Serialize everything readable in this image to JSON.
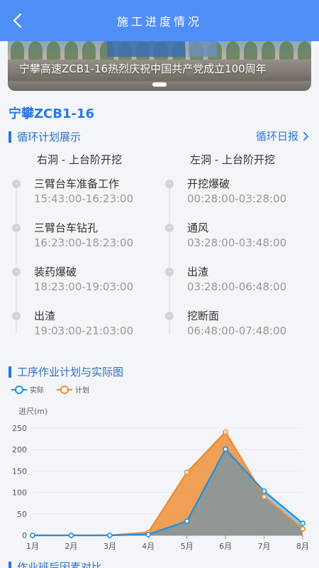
{
  "header": {
    "title": "施工进度情况",
    "back_icon": "chevron-left-icon"
  },
  "banner": {
    "caption": "宁攀高速ZCB1-16热烈庆祝中国共产党成立100周年"
  },
  "project": {
    "name": "宁攀ZCB1-16"
  },
  "cycle": {
    "section_title": "循环计划展示",
    "link_label": "循环日报",
    "left": {
      "heading": "右洞 - 上台阶开挖",
      "steps": [
        {
          "name": "三臂台车准备工作",
          "time": "15:43:00-16:23:00"
        },
        {
          "name": "三臂台车钻孔",
          "time": "16:23:00-18:23:00"
        },
        {
          "name": "装药爆破",
          "time": "18:23:00-19:03:00"
        },
        {
          "name": "出渣",
          "time": "19:03:00-21:03:00"
        }
      ]
    },
    "right": {
      "heading": "左洞 - 上台阶开挖",
      "steps": [
        {
          "name": "开挖爆破",
          "time": "00:28:00-03:28:00"
        },
        {
          "name": "通风",
          "time": "03:28:00-03:48:00"
        },
        {
          "name": "出渣",
          "time": "03:28:00-06:48:00"
        },
        {
          "name": "挖断面",
          "time": "06:48:00-07:48:00"
        }
      ]
    }
  },
  "process": {
    "section_title": "工序作业计划与实际图",
    "legend": {
      "actual": "实际",
      "plan": "计划"
    }
  },
  "chart_data": {
    "type": "area",
    "ylabel": "进尺(m)",
    "categories": [
      "1月",
      "2月",
      "3月",
      "4月",
      "5月",
      "6月",
      "7月",
      "8月"
    ],
    "ylim": [
      0,
      250
    ],
    "yticks": [
      0,
      50,
      100,
      150,
      200,
      250
    ],
    "grid": true,
    "legend_position": "top-left",
    "series": [
      {
        "name": "实际",
        "color": "#1e8fe0",
        "values": [
          0,
          0,
          0,
          2,
          33,
          201,
          103,
          28
        ]
      },
      {
        "name": "计划",
        "color": "#ee8a2e",
        "values": [
          0,
          0,
          0,
          7,
          147,
          241,
          90,
          15
        ]
      }
    ]
  },
  "next_section": {
    "title": "作业班后因素对比"
  },
  "colors": {
    "primary": "#2a78e4",
    "topbar": "#4f8ef7",
    "actual": "#1e8fe0",
    "plan": "#ee8a2e"
  }
}
